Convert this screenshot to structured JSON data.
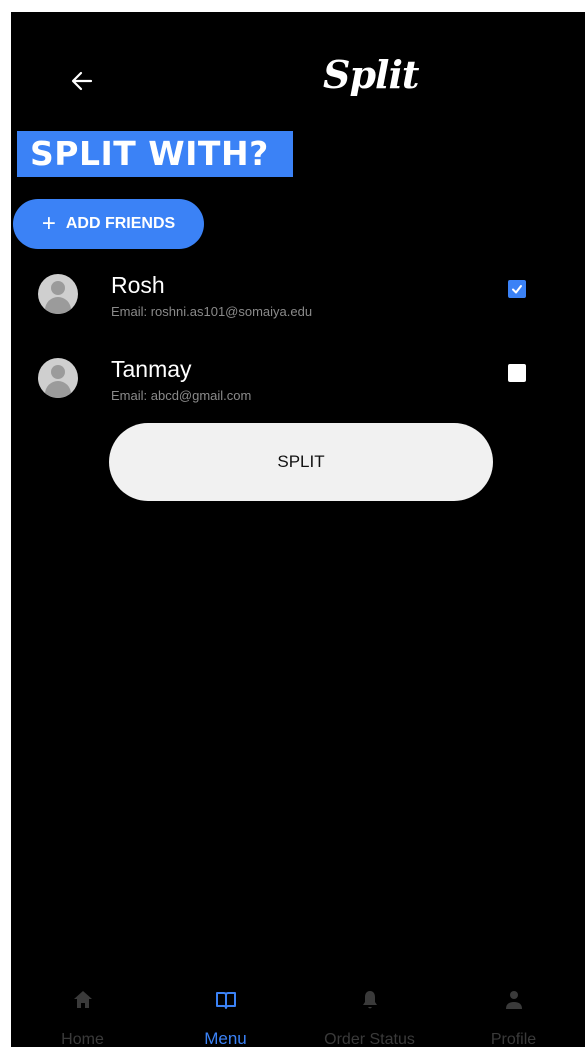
{
  "header": {
    "logo_text": "Split"
  },
  "page": {
    "title": "SPLIT WITH?",
    "add_friends_label": "ADD FRIENDS"
  },
  "friends": [
    {
      "name": "Rosh",
      "email": "Email: roshni.as101@somaiya.edu",
      "selected": true
    },
    {
      "name": "Tanmay",
      "email": "Email: abcd@gmail.com",
      "selected": false
    }
  ],
  "actions": {
    "split_label": "SPLIT"
  },
  "bottom_nav": {
    "items": [
      {
        "label": "Home",
        "icon": "home-icon",
        "active": false
      },
      {
        "label": "Menu",
        "icon": "book-icon",
        "active": true
      },
      {
        "label": "Order Status",
        "icon": "bell-icon",
        "active": false
      },
      {
        "label": "Profile",
        "icon": "person-icon",
        "active": false
      }
    ]
  },
  "colors": {
    "accent": "#3b82f6",
    "background": "#000000",
    "inactive_nav": "#3a3a3a"
  }
}
